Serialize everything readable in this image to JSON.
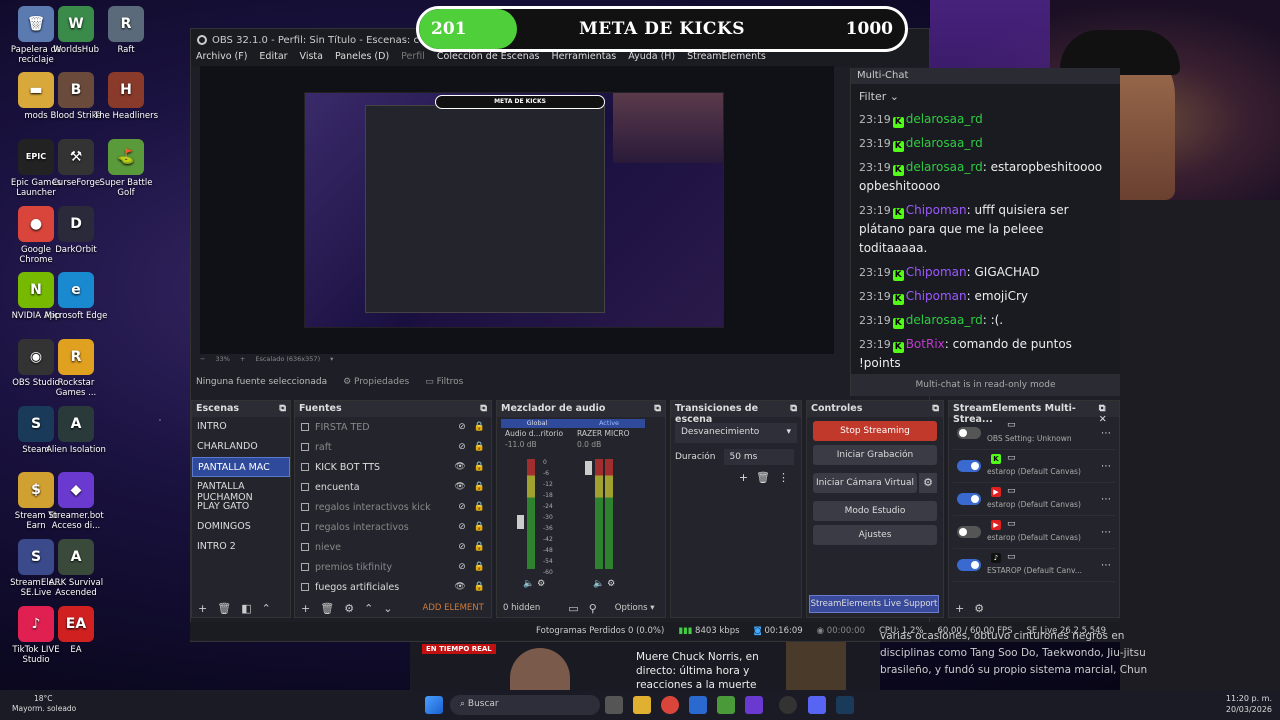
{
  "desktop_icons": [
    {
      "label": "Papelera de reciclaje",
      "icon": "recycle-bin-icon",
      "color": "#5a7ab0",
      "glyph": "🗑"
    },
    {
      "label": "WorldsHub",
      "icon": "worldshub-icon",
      "color": "#3a8a4a",
      "glyph": "W"
    },
    {
      "label": "Raft",
      "icon": "raft-icon",
      "color": "#5a6a7a",
      "glyph": "R"
    },
    {
      "label": "mods",
      "icon": "folder-icon",
      "color": "#d9a83a",
      "glyph": "▬"
    },
    {
      "label": "Blood Strike",
      "icon": "blood-strike-icon",
      "color": "#6a4a3a",
      "glyph": "B"
    },
    {
      "label": "The Headliners",
      "icon": "headliners-icon",
      "color": "#8a3a2a",
      "glyph": "H"
    },
    {
      "label": "Epic Games Launcher",
      "icon": "epic-games-icon",
      "color": "#222",
      "glyph": "EPIC"
    },
    {
      "label": "CurseForge",
      "icon": "curseforge-icon",
      "color": "#333",
      "glyph": "⚒"
    },
    {
      "label": "Super Battle Golf",
      "icon": "golf-icon",
      "color": "#5a9a3a",
      "glyph": "⛳"
    },
    {
      "label": "Google Chrome",
      "icon": "chrome-icon",
      "color": "#d9453a",
      "glyph": "●"
    },
    {
      "label": "DarkOrbit",
      "icon": "darkorbit-icon",
      "color": "#2a2a3a",
      "glyph": "D"
    },
    {
      "label": "NVIDIA App",
      "icon": "nvidia-icon",
      "color": "#76b900",
      "glyph": "N"
    },
    {
      "label": "Microsoft Edge",
      "icon": "edge-icon",
      "color": "#1a8ad0",
      "glyph": "e"
    },
    {
      "label": "OBS Studio",
      "icon": "obs-icon",
      "color": "#333",
      "glyph": "◉"
    },
    {
      "label": "Rockstar Games ...",
      "icon": "rockstar-icon",
      "color": "#e0a020",
      "glyph": "R"
    },
    {
      "label": "Steam",
      "icon": "steam-icon",
      "color": "#1a3a5a",
      "glyph": "S"
    },
    {
      "label": "Alien Isolation",
      "icon": "alien-icon",
      "color": "#2a3a3a",
      "glyph": "A"
    },
    {
      "label": "Stream To Earn",
      "icon": "stream-to-earn-icon",
      "color": "#d0a030",
      "glyph": "$"
    },
    {
      "label": "Streamer.bot Acceso di...",
      "icon": "streamerbot-icon",
      "color": "#6a3ad0",
      "glyph": "◆"
    },
    {
      "label": "StreamEle... SE.Live",
      "icon": "se-live-icon",
      "color": "#3a4a8a",
      "glyph": "S"
    },
    {
      "label": "ARK Survival Ascended",
      "icon": "ark-icon",
      "color": "#3a4a3a",
      "glyph": "A"
    },
    {
      "label": "TikTok LIVE Studio",
      "icon": "tiktok-icon",
      "color": "#e02050",
      "glyph": "♪"
    },
    {
      "label": "EA",
      "icon": "ea-icon",
      "color": "#d02020",
      "glyph": "EA"
    }
  ],
  "kicks_goal": {
    "current": "201",
    "title": "META DE KICKS",
    "target": "1000",
    "progress_fraction": 0.201,
    "fill_color": "#4fcf3a"
  },
  "obs": {
    "title": "OBS 32.1.0 - Perfil: Sin Título - Escenas: confi estarop",
    "menu": [
      "Archivo (F)",
      "Editar",
      "Vista",
      "Paneles (D)",
      "Perfil",
      "Colección de Escenas",
      "Herramientas",
      "Ayuda (H)",
      "StreamElements"
    ],
    "preview_mini_title": "META DE KICKS",
    "zoom_label": "33%",
    "scale_label": "Escalado (636x357)",
    "source_bar": {
      "no_source": "Ninguna fuente seleccionada",
      "properties": "Propiedades",
      "filters": "Filtros"
    },
    "scenes": {
      "title": "Escenas",
      "items": [
        "INTRO",
        "CHARLANDO",
        "PANTALLA MAC",
        "PANTALLA PUCHAMON",
        "PLAY GATO",
        "DOMINGOS",
        "INTRO 2"
      ],
      "active_index": 2
    },
    "sources": {
      "title": "Fuentes",
      "items": [
        {
          "name": "FIRSTA TED",
          "visible": false
        },
        {
          "name": "raft",
          "visible": false
        },
        {
          "name": "KICK BOT TTS",
          "visible": true
        },
        {
          "name": "encuenta",
          "visible": true
        },
        {
          "name": "regalos interactivos kick",
          "visible": false
        },
        {
          "name": "regalos interactivos",
          "visible": false
        },
        {
          "name": "nieve",
          "visible": false
        },
        {
          "name": "premios tikfinity",
          "visible": false
        },
        {
          "name": "fuegos artificiales",
          "visible": true
        }
      ],
      "add_element": "ADD ELEMENT"
    },
    "mixer": {
      "title": "Mezclador de audio",
      "channels": [
        {
          "tab": "Global",
          "name": "Audio d...ritorio",
          "db": "-11.0 dB",
          "level": 0.8
        },
        {
          "tab": "Active",
          "name": "RAZER MICRO",
          "db": "0.0 dB",
          "level": 0.85
        }
      ],
      "scale": [
        "0",
        "-6",
        "-12",
        "-18",
        "-24",
        "-30",
        "-36",
        "-42",
        "-48",
        "-54",
        "-60"
      ],
      "hidden_label": "0 hidden",
      "options_label": "Options"
    },
    "transitions": {
      "title": "Transiciones de escena",
      "selected": "Desvanecimiento",
      "duration_label": "Duración",
      "duration_value": "50 ms"
    },
    "controls": {
      "title": "Controles",
      "stop_streaming": "Stop Streaming",
      "start_recording": "Iniciar Grabación",
      "virtual_cam": "Iniciar Cámara Virtual",
      "studio_mode": "Modo Estudio",
      "settings": "Ajustes",
      "support": "StreamElements Live Support"
    },
    "se_multistream": {
      "title": "StreamElements Multi-Strea...",
      "rows": [
        {
          "label": "OBS Setting: Unknown",
          "enabled": false,
          "platform": ""
        },
        {
          "label": "estarop (Default Canvas)",
          "enabled": true,
          "platform": "kick"
        },
        {
          "label": "estarop (Default Canvas)",
          "enabled": true,
          "platform": "youtube"
        },
        {
          "label": "estarop (Default Canvas)",
          "enabled": false,
          "platform": "youtube"
        },
        {
          "label": "ESTAROP (Default Canv...",
          "enabled": true,
          "platform": "tiktok"
        }
      ]
    },
    "status": {
      "dropped": "Fotogramas Perdidos 0 (0.0%)",
      "kbps": "8403 kbps",
      "stream_time": "00:16:09",
      "rec_time": "00:00:00",
      "cpu": "CPU: 1.2%",
      "fps": "60.00 / 60.00 FPS",
      "version": "SE.Live 26.2.5.549"
    }
  },
  "chat": {
    "title": "Multi-Chat",
    "filter": "Filter",
    "messages": [
      {
        "time": "23:19",
        "user": "delarosaa_rd",
        "text": "",
        "color": "#2ecc40"
      },
      {
        "time": "23:19",
        "user": "delarosaa_rd",
        "text": "",
        "color": "#2ecc40"
      },
      {
        "time": "23:19",
        "user": "delarosaa_rd",
        "text": "estaropbeshitoooo opbeshitoooo",
        "color": "#2ecc40"
      },
      {
        "time": "23:19",
        "user": "Chipoman",
        "text": "ufff quisiera ser plátano para que me la peleee toditaaaaa.",
        "color": "#9b59ff"
      },
      {
        "time": "23:19",
        "user": "Chipoman",
        "text": "GIGACHAD",
        "color": "#9b59ff"
      },
      {
        "time": "23:19",
        "user": "Chipoman",
        "text": "emojiCry",
        "color": "#9b59ff"
      },
      {
        "time": "23:19",
        "user": "delarosaa_rd",
        "text": ":(.",
        "color": "#2ecc40"
      },
      {
        "time": "23:19",
        "user": "BotRix",
        "text": "comando de puntos !points",
        "color": "#c03ad0"
      }
    ],
    "readonly": "Multi-chat is in read-only mode"
  },
  "news": {
    "live_tag": "EN TIEMPO REAL",
    "headline": "Muere Chuck Norris, en directo: última hora y reacciones a la muerte del...",
    "article": "varias ocasiones, obtuvo cinturones negros en disciplinas como Tang Soo Do, Taekwondo, Jiu-jitsu brasileño, y fundó su propio sistema marcial, Chun"
  },
  "taskbar": {
    "temp": "18°C",
    "weather": "Mayorm. soleado",
    "search": "Buscar",
    "time": "11:20 p. m.",
    "date": "20/03/2026"
  }
}
